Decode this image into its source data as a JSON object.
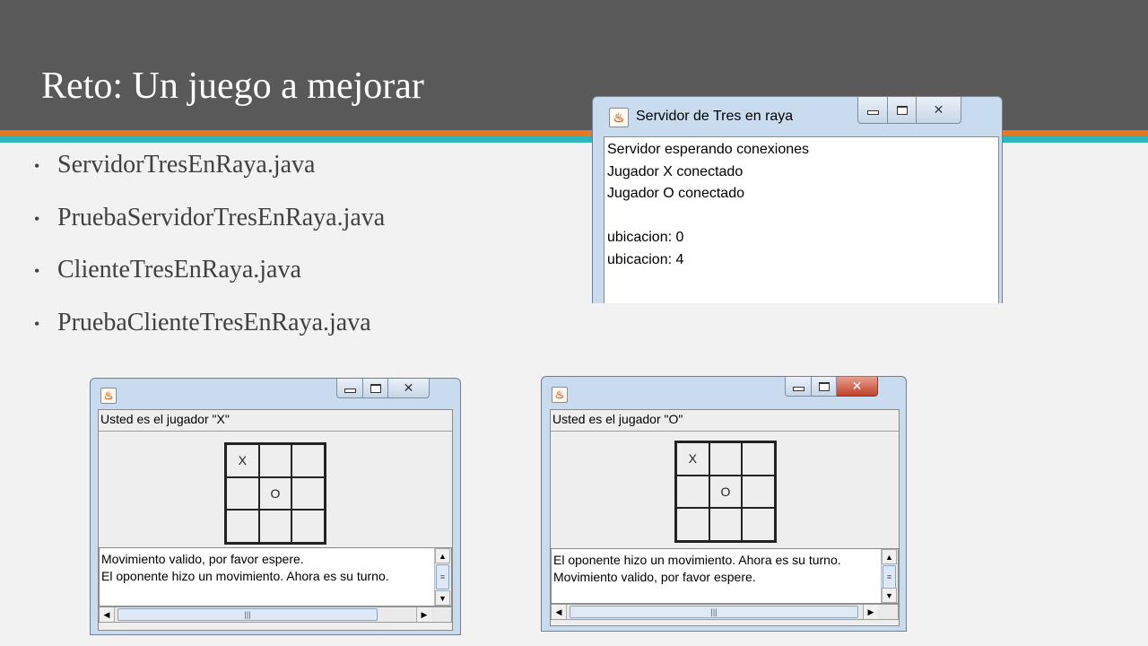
{
  "slide": {
    "title": "Reto: Un juego a mejorar",
    "bullet_marker": "•",
    "bullets": [
      "ServidorTresEnRaya.java",
      "PruebaServidorTresEnRaya.java",
      "ClienteTresEnRaya.java",
      "PruebaClienteTresEnRaya.java"
    ]
  },
  "server_window": {
    "title": "Servidor de Tres en raya",
    "log": [
      "Servidor esperando conexiones",
      "Jugador X conectado",
      "Jugador O conectado",
      "",
      "ubicacion: 0",
      "ubicacion: 4"
    ]
  },
  "client_x": {
    "player_label": "Usted es el jugador \"X\"",
    "board": [
      "X",
      "",
      "",
      "",
      "O",
      "",
      "",
      "",
      ""
    ],
    "messages": [
      "Movimiento valido, por favor espere.",
      "El oponente hizo un movimiento. Ahora es su turno."
    ]
  },
  "client_o": {
    "player_label": "Usted es el jugador \"O\"",
    "board": [
      "X",
      "",
      "",
      "",
      "O",
      "",
      "",
      "",
      ""
    ],
    "messages": [
      "El oponente hizo un movimiento. Ahora es su turno.",
      "Movimiento valido, por favor espere."
    ]
  },
  "controls": {
    "close_glyph": "✕",
    "scroll_up": "▲",
    "scroll_down": "▼",
    "scroll_left": "◀",
    "scroll_right": "▶",
    "thumb_grip": "≡",
    "thumb_grip_h": "|||",
    "java_glyph": "♨"
  },
  "colors": {
    "banner": "#595959",
    "stripe_orange": "#e87722",
    "stripe_teal": "#2fb5b8",
    "close_active": "#c0412a"
  },
  "icons": [
    "java-icon",
    "minimize-icon",
    "maximize-icon",
    "close-icon"
  ]
}
